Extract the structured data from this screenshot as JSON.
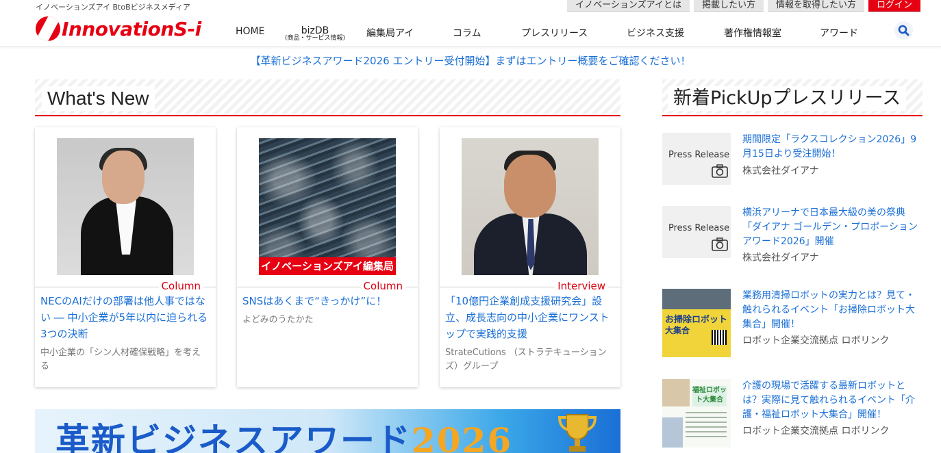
{
  "header": {
    "tagline": "イノベーションズアイ BtoBビジネスメディア",
    "logo_text": "InnovationS-i",
    "top_links": [
      {
        "label": "イノベーションズアイとは"
      },
      {
        "label": "掲載したい方"
      },
      {
        "label": "情報を取得したい方"
      },
      {
        "label": "ログイン"
      }
    ],
    "nav": [
      {
        "label": "HOME"
      },
      {
        "label": "bizDB",
        "sub": "(商品・サービス情報)"
      },
      {
        "label": "編集局アイ"
      },
      {
        "label": "コラム"
      },
      {
        "label": "プレスリリース"
      },
      {
        "label": "ビジネス支援"
      },
      {
        "label": "著作権情報室"
      },
      {
        "label": "アワード"
      }
    ],
    "search_icon": "search-icon"
  },
  "announcement": "【革新ビジネスアワード2026 エントリー受付開始】まずはエントリー概要をご確認ください！",
  "whats_new": {
    "heading": "What's New",
    "cards": [
      {
        "category": "Column",
        "title": "NECのAIだけの部署は他人事ではない ― 中小企業が5年以内に迫られる3つの決断",
        "author": "中小企業の「シン人材確保戦略」を考える"
      },
      {
        "category": "Column",
        "title": "SNSはあくまで“きっかけ”に！",
        "author": "よどみのうたかた",
        "image_label": "イノベーションズアイ編集局"
      },
      {
        "category": "Interview",
        "title": "「10億円企業創成支援研究会」設立、成長志向の中小企業にワンストップで実践的支援",
        "author": "StrateCutions （ストラテキューションズ）グループ"
      }
    ]
  },
  "award_banner": {
    "text": "革新ビジネスアワード",
    "year": "2026"
  },
  "pickup": {
    "heading": "新着PickUpプレスリリース",
    "placeholder_label": "Press Release",
    "items": [
      {
        "title": "期間限定「ラクスコレクション2026」9月15日より受注開始！",
        "company": "株式会社ダイアナ",
        "thumb": "press-release"
      },
      {
        "title": "横浜アリーナで日本最大級の美の祭典「ダイアナ ゴールデン・プロポーションアワード2026」開催",
        "company": "株式会社ダイアナ",
        "thumb": "press-release"
      },
      {
        "title": "業務用清掃ロボットの実力とは？見て・触れられるイベント「お掃除ロボット大集合」開催！",
        "company": "ロボット企業交流拠点 ロボリンク",
        "thumb": "flyer",
        "flyer_title": "お掃除ロボット",
        "flyer_sub": "大集合"
      },
      {
        "title": "介護の現場で活躍する最新ロボットとは？実際に見て触れられるイベント「介護・福祉ロボット大集合」開催！",
        "company": "ロボット企業交流拠点 ロボリンク",
        "thumb": "flyer",
        "flyer_title": "福祉ロボット大集合"
      }
    ]
  },
  "colors": {
    "brand_red": "#e60012",
    "link_blue": "#1a6fd6"
  }
}
